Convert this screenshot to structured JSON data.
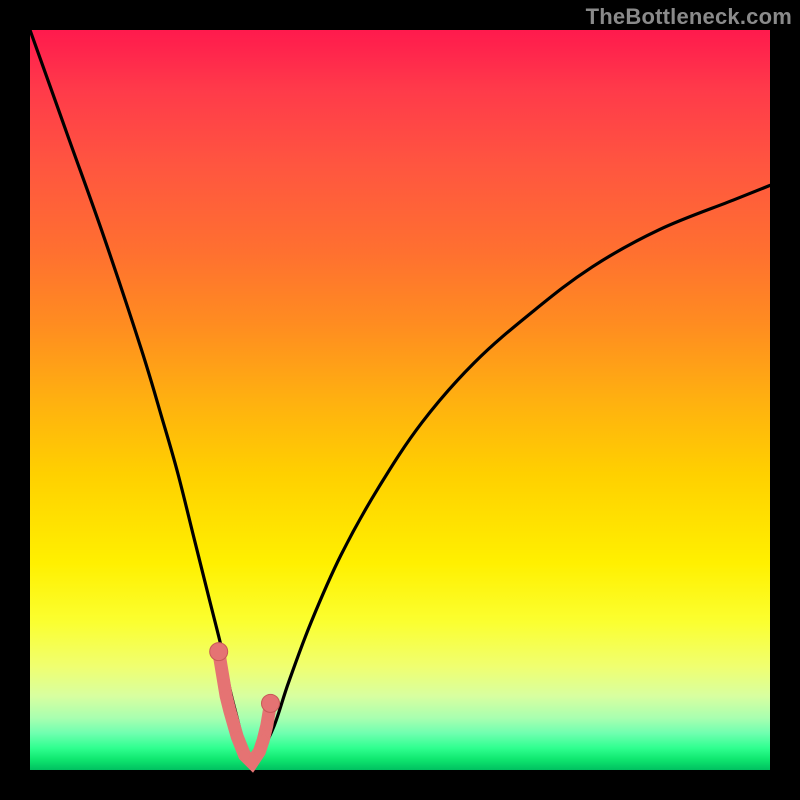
{
  "watermark": "TheBottleneck.com",
  "chart_data": {
    "type": "line",
    "title": "",
    "xlabel": "",
    "ylabel": "",
    "xlim": [
      0,
      100
    ],
    "ylim": [
      0,
      100
    ],
    "grid": false,
    "series": [
      {
        "name": "bottleneck-curve",
        "x": [
          0,
          5,
          10,
          15,
          18,
          20,
          22,
          24,
          26,
          27,
          28,
          29,
          30,
          31,
          33,
          35,
          38,
          42,
          47,
          53,
          60,
          68,
          76,
          85,
          95,
          100
        ],
        "y": [
          100,
          86,
          72,
          57,
          47,
          40,
          32,
          24,
          16,
          11,
          7,
          3,
          1,
          2,
          6,
          12,
          20,
          29,
          38,
          47,
          55,
          62,
          68,
          73,
          77,
          79
        ]
      }
    ],
    "highlight_points": {
      "name": "measured-range",
      "x": [
        25.5,
        26,
        26.5,
        27,
        28,
        29,
        30,
        31,
        31.5,
        32,
        32.5
      ],
      "y": [
        16,
        13,
        10,
        8,
        4.5,
        2,
        1,
        2.5,
        4,
        6,
        9
      ]
    },
    "background_gradient": {
      "orientation": "vertical",
      "stops": [
        {
          "pos": 0.0,
          "color": "#ff1a4d"
        },
        {
          "pos": 0.3,
          "color": "#ff7030"
        },
        {
          "pos": 0.6,
          "color": "#ffd000"
        },
        {
          "pos": 0.86,
          "color": "#f0ff70"
        },
        {
          "pos": 1.0,
          "color": "#00c060"
        }
      ]
    }
  }
}
